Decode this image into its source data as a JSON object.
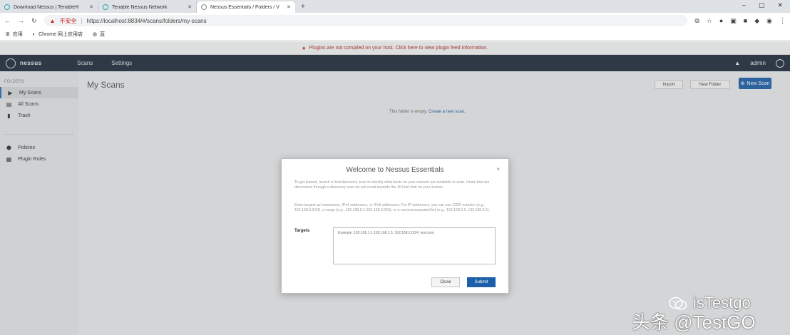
{
  "browser": {
    "tabs": [
      {
        "label": "Download Nessus | Tenable®",
        "active": false
      },
      {
        "label": "Tenable Nessus Network",
        "active": false
      },
      {
        "label": "Nessus Essentials / Folders / V",
        "active": true
      }
    ],
    "new_tab": "+",
    "window_controls": [
      "–",
      "▢",
      "✕"
    ],
    "address": {
      "insecure_label": "不安全",
      "url": "https://localhost:8834/#/scans/folders/my-scans"
    },
    "bookmarks": [
      {
        "label": "应用",
        "icon": "apps-grid-icon"
      },
      {
        "label": "Chrome 网上应用店",
        "icon": "chrome-store-icon"
      },
      {
        "label": "蓝",
        "icon": "globe-icon"
      }
    ]
  },
  "app": {
    "banner": "Plugins are not compiled on your host. Click here to view plugin feed information.",
    "logo": "nessus",
    "nav": [
      "Scans",
      "Settings"
    ],
    "user": "admin",
    "sidebar": {
      "section1": "FOLDERS",
      "folders": [
        {
          "label": "My Scans",
          "icon": "folder-icon",
          "active": true
        },
        {
          "label": "All Scans",
          "icon": "folders-icon",
          "active": false
        },
        {
          "label": "Trash",
          "icon": "trash-icon",
          "active": false
        }
      ],
      "resources": [
        {
          "label": "Policies",
          "icon": "policies-icon"
        },
        {
          "label": "Plugin Rules",
          "icon": "plugin-rules-icon"
        }
      ]
    },
    "page_title": "My Scans",
    "toolbar": {
      "import": "Import",
      "new_folder": "New Folder",
      "new_scan": "New Scan"
    },
    "empty_message": "This folder is empty.",
    "empty_link": "Create a new scan."
  },
  "modal": {
    "title": "Welcome to Nessus Essentials",
    "close_x": "×",
    "para1": "To get started, launch a host discovery scan to identify what hosts on your network are available to scan. Hosts that are discovered through a discovery scan do not count towards the 16 host limit on your license.",
    "para2": "Enter targets as hostnames, IPv4 addresses, or IPv6 addresses. For IP addresses, you can use CIDR notation (e.g., 192.168.0.0/24), a range (e.g., 192.168.0.1-192.168.0.255), or a comma-separated list (e.g., 192.168.0.0, 192.168.0.1).",
    "targets_label": "Targets",
    "targets_placeholder": "Example: 192.168.1.1-192.168.1.5, 192.168.2.0/24, test.com",
    "close_button": "Close",
    "submit_button": "Submit"
  },
  "watermark": {
    "line1": "isTestgo",
    "line2": "头条 @TestGO"
  }
}
